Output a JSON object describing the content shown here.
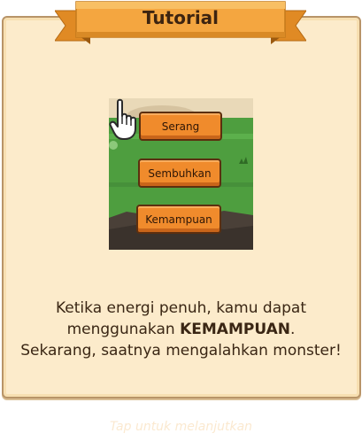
{
  "tutorial": {
    "title": "Tutorial",
    "message_line1": "Ketika energi penuh, kamu dapat",
    "message_line2_pre": "menggunakan ",
    "message_line2_bold": "KEMAMPUAN",
    "message_line2_post": ".",
    "message_line3": "Sekarang, saatnya mengalahkan monster!",
    "continue_hint": "Tap untuk melanjutkan"
  },
  "preview": {
    "buttons": [
      {
        "label": "Serang"
      },
      {
        "label": "Sembuhkan"
      },
      {
        "label": "Kemampuan"
      }
    ],
    "pointer_icon": "pointing-hand-icon"
  },
  "colors": {
    "panel_bg": "#fcebcb",
    "panel_border": "#b89468",
    "ribbon": "#f4a640",
    "button": "#f08b2c",
    "text": "#3a2614"
  }
}
